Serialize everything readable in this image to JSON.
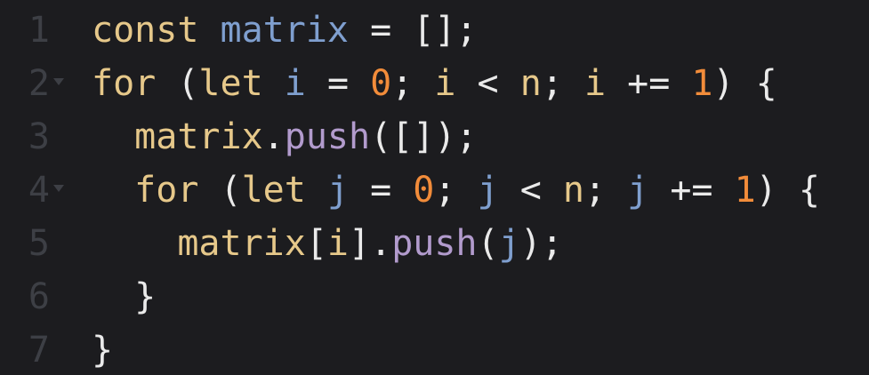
{
  "colors": {
    "background": "#1c1c1f",
    "gutter": "#3d3f45",
    "keyword": "#e6c88a",
    "variable": "#7f9fcf",
    "number": "#f28c3a",
    "method": "#b29bcd",
    "punctuation": "#eaeaea"
  },
  "lines": [
    {
      "number": "1",
      "fold": false,
      "indent": "",
      "tokens": [
        {
          "t": "const",
          "k": "kw"
        },
        {
          "t": " ",
          "k": "op"
        },
        {
          "t": "matrix",
          "k": "var"
        },
        {
          "t": " = ",
          "k": "op"
        },
        {
          "t": "[];",
          "k": "op"
        }
      ]
    },
    {
      "number": "2",
      "fold": true,
      "indent": "",
      "tokens": [
        {
          "t": "for",
          "k": "kw"
        },
        {
          "t": " (",
          "k": "op"
        },
        {
          "t": "let",
          "k": "kw"
        },
        {
          "t": " ",
          "k": "op"
        },
        {
          "t": "i",
          "k": "var"
        },
        {
          "t": " = ",
          "k": "op"
        },
        {
          "t": "0",
          "k": "num"
        },
        {
          "t": "; ",
          "k": "op"
        },
        {
          "t": "i",
          "k": "kw"
        },
        {
          "t": " < ",
          "k": "op"
        },
        {
          "t": "n",
          "k": "kw"
        },
        {
          "t": "; ",
          "k": "op"
        },
        {
          "t": "i",
          "k": "kw"
        },
        {
          "t": " += ",
          "k": "op"
        },
        {
          "t": "1",
          "k": "num"
        },
        {
          "t": ") {",
          "k": "op"
        }
      ]
    },
    {
      "number": "3",
      "fold": false,
      "indent": "  ",
      "tokens": [
        {
          "t": "matrix",
          "k": "kw"
        },
        {
          "t": ".",
          "k": "op"
        },
        {
          "t": "push",
          "k": "fn"
        },
        {
          "t": "([]);",
          "k": "op"
        }
      ]
    },
    {
      "number": "4",
      "fold": true,
      "indent": "  ",
      "tokens": [
        {
          "t": "for",
          "k": "kw"
        },
        {
          "t": " (",
          "k": "op"
        },
        {
          "t": "let",
          "k": "kw"
        },
        {
          "t": " ",
          "k": "op"
        },
        {
          "t": "j",
          "k": "var"
        },
        {
          "t": " = ",
          "k": "op"
        },
        {
          "t": "0",
          "k": "num"
        },
        {
          "t": "; ",
          "k": "op"
        },
        {
          "t": "j",
          "k": "var"
        },
        {
          "t": " < ",
          "k": "op"
        },
        {
          "t": "n",
          "k": "kw"
        },
        {
          "t": "; ",
          "k": "op"
        },
        {
          "t": "j",
          "k": "var"
        },
        {
          "t": " += ",
          "k": "op"
        },
        {
          "t": "1",
          "k": "num"
        },
        {
          "t": ") {",
          "k": "op"
        }
      ]
    },
    {
      "number": "5",
      "fold": false,
      "indent": "    ",
      "tokens": [
        {
          "t": "matrix",
          "k": "kw"
        },
        {
          "t": "[",
          "k": "op"
        },
        {
          "t": "i",
          "k": "kw"
        },
        {
          "t": "].",
          "k": "op"
        },
        {
          "t": "push",
          "k": "fn"
        },
        {
          "t": "(",
          "k": "op"
        },
        {
          "t": "j",
          "k": "var"
        },
        {
          "t": ");",
          "k": "op"
        }
      ]
    },
    {
      "number": "6",
      "fold": false,
      "indent": "  ",
      "tokens": [
        {
          "t": "}",
          "k": "op"
        }
      ]
    },
    {
      "number": "7",
      "fold": false,
      "indent": "",
      "tokens": [
        {
          "t": "}",
          "k": "op"
        }
      ]
    }
  ]
}
